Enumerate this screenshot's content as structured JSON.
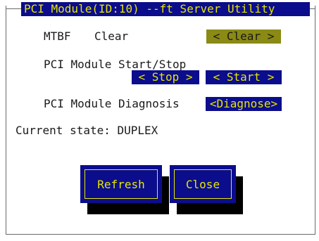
{
  "window": {
    "title": "PCI Module(ID:10) --ft Server Utility"
  },
  "rows": {
    "mtbf_label": "MTBF",
    "mtbf_value": "Clear",
    "mtbf_button": "< Clear >",
    "startstop_label": "PCI Module Start/Stop",
    "stop_button": "< Stop >",
    "start_button": "< Start >",
    "diagnosis_label": "PCI Module Diagnosis",
    "diagnose_button": "<Diagnose>",
    "current_state": "Current state: DUPLEX"
  },
  "actions": {
    "refresh_label": "Refresh",
    "close_label": "Close"
  },
  "colors": {
    "title_bg": "#0b0d8c",
    "title_fg": "#e6e600",
    "focused_button_bg": "#8a8a14",
    "button_bg": "#0b0d8c",
    "shadow": "#000000"
  }
}
